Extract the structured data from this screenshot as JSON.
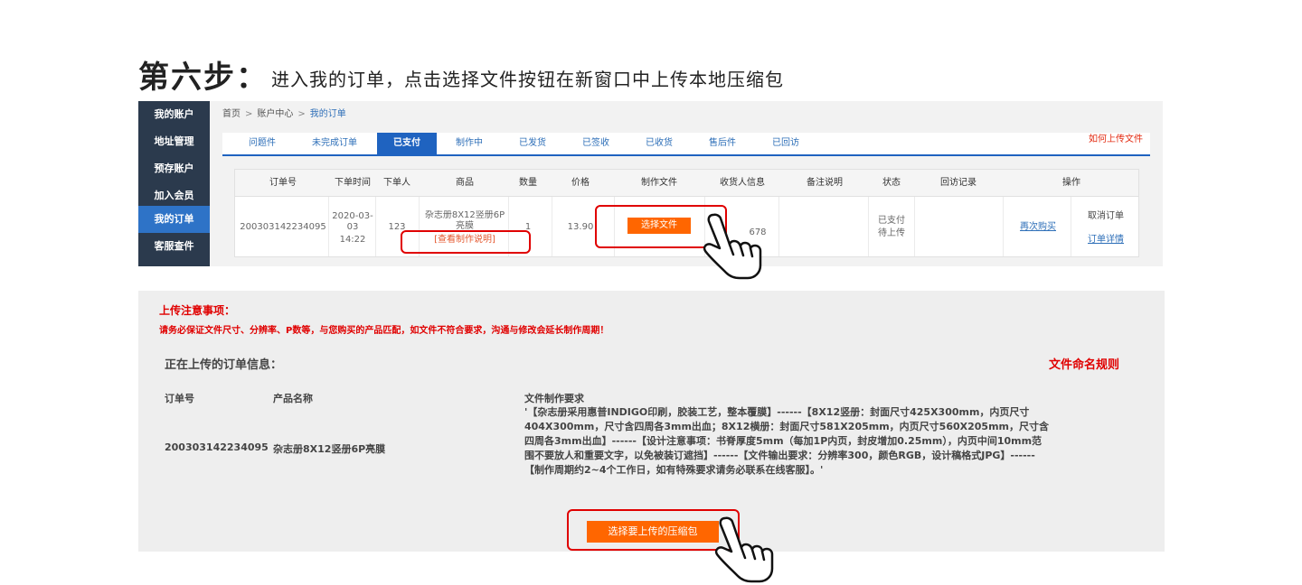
{
  "heading": {
    "step": "第六步：",
    "description": "进入我的订单，点击选择文件按钮在新窗口中上传本地压缩包"
  },
  "sidebar": {
    "items": [
      {
        "label": "我的账户"
      },
      {
        "label": "地址管理"
      },
      {
        "label": "预存账户"
      },
      {
        "label": "加入会员"
      },
      {
        "label": "我的订单"
      },
      {
        "label": "客服查件"
      }
    ],
    "active": "我的订单"
  },
  "breadcrumb": {
    "home": "首页",
    "sep": ">",
    "account": "账户中心",
    "current": "我的订单"
  },
  "tabs": {
    "items": [
      "问题件",
      "未完成订单",
      "已支付",
      "制作中",
      "已发货",
      "已签收",
      "已收货",
      "售后件",
      "已回访"
    ],
    "active": "已支付",
    "help_link": "如何上传文件"
  },
  "orders_table": {
    "headers": [
      "订单号",
      "下单时间",
      "下单人",
      "商品",
      "数量",
      "价格",
      "制作文件",
      "收货人信息",
      "备注说明",
      "状态",
      "回访记录",
      "操作"
    ],
    "row": {
      "order_no": "200303142234095",
      "date": "2020-03-03",
      "time": "14:22",
      "buyer": "123",
      "product": "杂志册8X12竖册6P亮膜",
      "product_note_link": "[查看制作说明]",
      "quantity": "1",
      "price": "13.90",
      "select_file_button": "选择文件",
      "receiver_partial": "678",
      "status_line1": "已支付",
      "status_line2": "待上传",
      "rebuy_link": "再次购买",
      "cancel_order": "取消订单",
      "order_detail_link": "订单详情"
    }
  },
  "upload_panel": {
    "notice_title": "上传注意事项：",
    "notice_text": "请务必保证文件尺寸、分辨率、P数等，与您购买的产品匹配，如文件不符合要求，沟通与修改会延长制作周期！",
    "info_title": "正在上传的订单信息：",
    "naming_rules_link": "文件命名规则",
    "order_no_label": "订单号",
    "product_name_label": "产品名称",
    "requirements_label": "文件制作要求",
    "order_no": "200303142234095",
    "product_name": "杂志册8X12竖册6P亮膜",
    "requirements_text": "'【杂志册采用惠普INDIGO印刷，胶装工艺，整本覆膜】------【8X12竖册：封面尺寸425X300mm，内页尺寸404X300mm，尺寸含四周各3mm出血；8X12横册：封面尺寸581X205mm，内页尺寸560X205mm，尺寸含四周各3mm出血】------【设计注意事项：书脊厚度5mm（每加1P内页，封皮增加0.25mm），内页中间10mm范围不要放人和重要文字，以免被装订遮挡】------【文件输出要求：分辨率300，颜色RGB，设计稿格式JPG】------【制作周期约2~4个工作日，如有特殊要求请务必联系在线客服】。'",
    "upload_button": "选择要上传的压缩包"
  },
  "colors": {
    "accent_blue": "#1f63c0",
    "sidebar_dark": "#2b3a4d",
    "orange_button": "#ff6600",
    "highlight_red": "#e00000"
  }
}
